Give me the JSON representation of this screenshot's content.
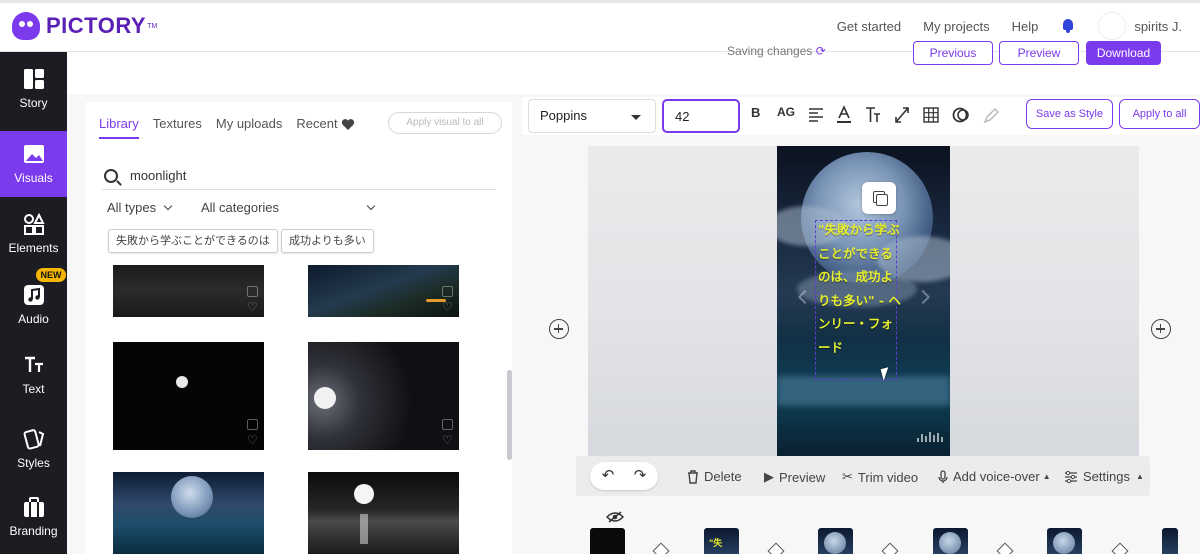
{
  "app": {
    "brand": "PICTORY",
    "brand_tm": "TM"
  },
  "nav": {
    "links": [
      "Get started",
      "My projects",
      "Help"
    ],
    "username": "spirits J."
  },
  "rail": {
    "items": [
      {
        "label": "Story",
        "icon": "story-icon"
      },
      {
        "label": "Visuals",
        "icon": "image-icon",
        "active": true
      },
      {
        "label": "Elements",
        "icon": "shapes-icon"
      },
      {
        "label": "Audio",
        "icon": "music-note-icon",
        "badge": "NEW"
      },
      {
        "label": "Text",
        "icon": "text-icon"
      },
      {
        "label": "Styles",
        "icon": "cards-icon"
      },
      {
        "label": "Branding",
        "icon": "briefcase-icon"
      }
    ]
  },
  "actions": {
    "saving": "Saving changes",
    "previous": "Previous",
    "preview": "Preview",
    "download": "Download"
  },
  "library": {
    "tabs": [
      "Library",
      "Textures",
      "My uploads",
      "Recent"
    ],
    "apply_visual": "Apply visual to all",
    "search_value": "moonlight",
    "filter_type": "All types",
    "filter_category": "All categories",
    "chips": [
      "失敗から学ぶことができるのは",
      "成功よりも多い"
    ]
  },
  "texttool": {
    "font": "Poppins",
    "size": "42",
    "bold": "B",
    "case": "AG",
    "save_style": "Save as Style",
    "apply_all": "Apply to all"
  },
  "canvas": {
    "caption": "\"失敗から学ぶことができるのは、成功よりも多い\" - ヘンリー・フォード"
  },
  "controls": {
    "delete": "Delete",
    "preview": "Preview",
    "trim": "Trim video",
    "voiceover": "Add voice-over",
    "settings": "Settings"
  },
  "timeline": {
    "scene_label": "\"失"
  },
  "colors": {
    "accent": "#7c3aed",
    "rail": "#1c1c22",
    "caption": "#e6ee2e"
  }
}
